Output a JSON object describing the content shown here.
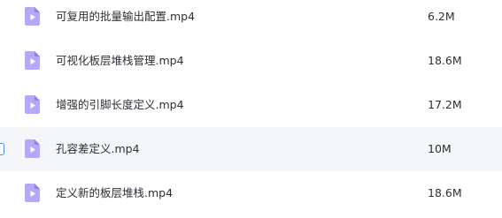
{
  "files": [
    {
      "name": "可复用的批量输出配置.mp4",
      "size": "6.2M",
      "icon": "video-file-icon",
      "selected": false
    },
    {
      "name": "可视化板层堆栈管理.mp4",
      "size": "18.6M",
      "icon": "video-file-icon",
      "selected": false
    },
    {
      "name": "增强的引脚长度定义.mp4",
      "size": "17.2M",
      "icon": "video-file-icon",
      "selected": false
    },
    {
      "name": "孔容差定义.mp4",
      "size": "10M",
      "icon": "video-file-icon",
      "selected": true
    },
    {
      "name": "定义新的板层堆栈.mp4",
      "size": "18.6M",
      "icon": "video-file-icon",
      "selected": false
    }
  ],
  "colors": {
    "icon_light": "#b6a8f7",
    "icon_dark": "#8f7cf0",
    "selected_row_bg": "#f5f6fa",
    "checkbox_border": "#4a8df5"
  }
}
